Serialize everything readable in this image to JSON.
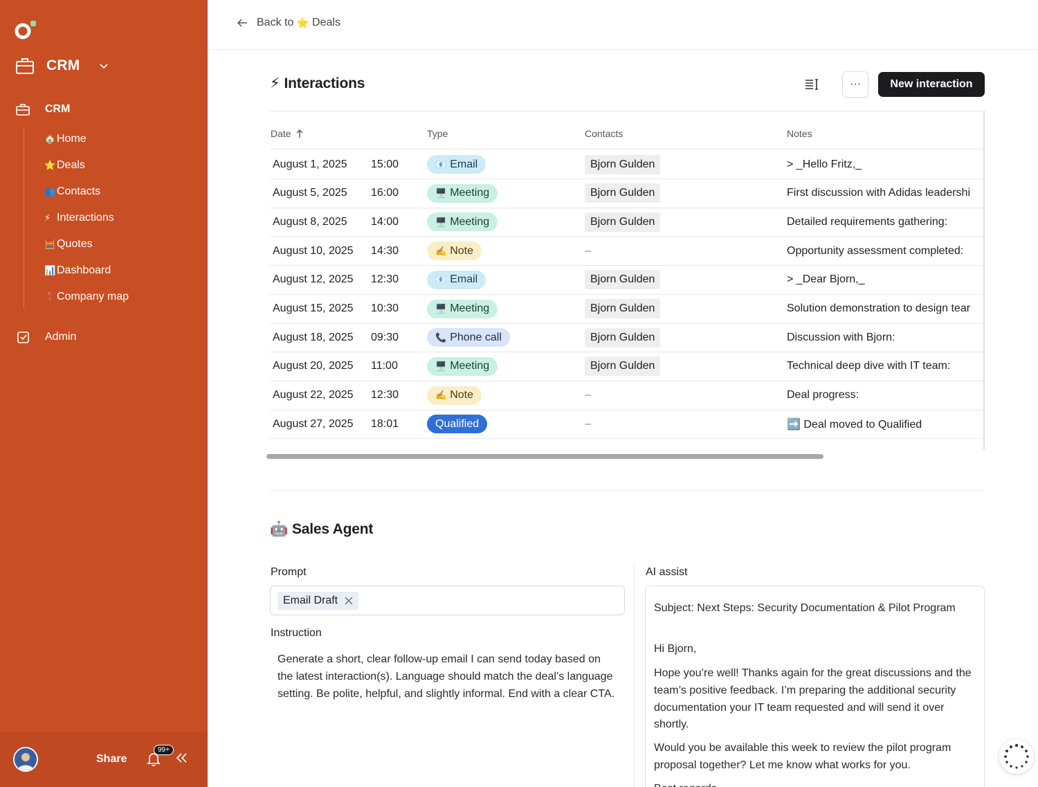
{
  "sidebar": {
    "workspace_title": "CRM",
    "sections": [
      {
        "label": "CRM"
      },
      {
        "label": "Admin"
      }
    ],
    "items": [
      {
        "emoji": "🏠",
        "label": "Home"
      },
      {
        "emoji": "⭐",
        "label": "Deals"
      },
      {
        "emoji": "👥",
        "label": "Contacts"
      },
      {
        "emoji": "⚡",
        "label": "Interactions"
      },
      {
        "emoji": "🧮",
        "label": "Quotes"
      },
      {
        "emoji": "📊",
        "label": "Dashboard"
      },
      {
        "emoji": "📍",
        "label": "Company map"
      }
    ],
    "footer": {
      "share_label": "Share",
      "notification_badge": "99+"
    }
  },
  "topbar": {
    "back_prefix": "Back to",
    "back_emoji": "⭐",
    "back_target": "Deals"
  },
  "interactions": {
    "title_emoji": "⚡",
    "title": "Interactions",
    "more_label": "···",
    "new_button_label": "New interaction",
    "columns": {
      "date": "Date",
      "type": "Type",
      "contacts": "Contacts",
      "notes": "Notes"
    },
    "rows": [
      {
        "date": "August 1, 2025",
        "time": "15:00",
        "type": "Email",
        "type_emoji": "📧",
        "type_style": "email",
        "contact": "Bjorn Gulden",
        "notes": "> _Hello Fritz,_"
      },
      {
        "date": "August 5, 2025",
        "time": "16:00",
        "type": "Meeting",
        "type_emoji": "🖥️",
        "type_style": "meeting",
        "contact": "Bjorn Gulden",
        "notes": "First discussion with Adidas leadershi"
      },
      {
        "date": "August 8, 2025",
        "time": "14:00",
        "type": "Meeting",
        "type_emoji": "🖥️",
        "type_style": "meeting",
        "contact": "Bjorn Gulden",
        "notes": "Detailed requirements gathering:"
      },
      {
        "date": "August 10, 2025",
        "time": "14:30",
        "type": "Note",
        "type_emoji": "✍️",
        "type_style": "note",
        "contact": "–",
        "notes": "Opportunity assessment completed:"
      },
      {
        "date": "August 12, 2025",
        "time": "12:30",
        "type": "Email",
        "type_emoji": "📧",
        "type_style": "email",
        "contact": "Bjorn Gulden",
        "notes": "> _Dear Bjorn,_"
      },
      {
        "date": "August 15, 2025",
        "time": "10:30",
        "type": "Meeting",
        "type_emoji": "🖥️",
        "type_style": "meeting",
        "contact": "Bjorn Gulden",
        "notes": "Solution demonstration to design tear"
      },
      {
        "date": "August 18, 2025",
        "time": "09:30",
        "type": "Phone call",
        "type_emoji": "📞",
        "type_style": "phone",
        "contact": "Bjorn Gulden",
        "notes": "Discussion with Bjorn:"
      },
      {
        "date": "August 20, 2025",
        "time": "11:00",
        "type": "Meeting",
        "type_emoji": "🖥️",
        "type_style": "meeting",
        "contact": "Bjorn Gulden",
        "notes": "Technical deep dive with IT team:"
      },
      {
        "date": "August 22, 2025",
        "time": "12:30",
        "type": "Note",
        "type_emoji": "✍️",
        "type_style": "note",
        "contact": "–",
        "notes": "Deal progress:"
      },
      {
        "date": "August 27, 2025",
        "time": "18:01",
        "type": "Qualified",
        "type_emoji": "",
        "type_style": "qualified",
        "contact": "–",
        "notes": "➡️ Deal moved to Qualified"
      }
    ]
  },
  "sales_agent": {
    "title_emoji": "🤖",
    "title": "Sales Agent",
    "prompt_label": "Prompt",
    "prompt_chip": "Email Draft",
    "instruction_label": "Instruction",
    "instruction_text": "Generate a short, clear follow-up email I can send today based on the latest interaction(s). Language should match the deal’s language setting. Be polite, helpful, and slightly informal. End with a clear CTA.",
    "ai_assist_label": "AI assist",
    "ai_paragraphs": [
      "Subject: Next Steps: Security Documentation & Pilot Program",
      "Hi Bjorn,",
      "Hope you’re well! Thanks again for the great discussions and the team’s positive feedback. I’m preparing the additional security documentation your IT team requested and will send it over shortly.",
      "Would you be available this week to review the pilot program proposal together? Let me know what works for you.",
      "Best regards,"
    ]
  },
  "colors": {
    "sidebar": "#c84e24",
    "primary_button": "#1c1c1e",
    "qualified": "#2f6fd6"
  }
}
